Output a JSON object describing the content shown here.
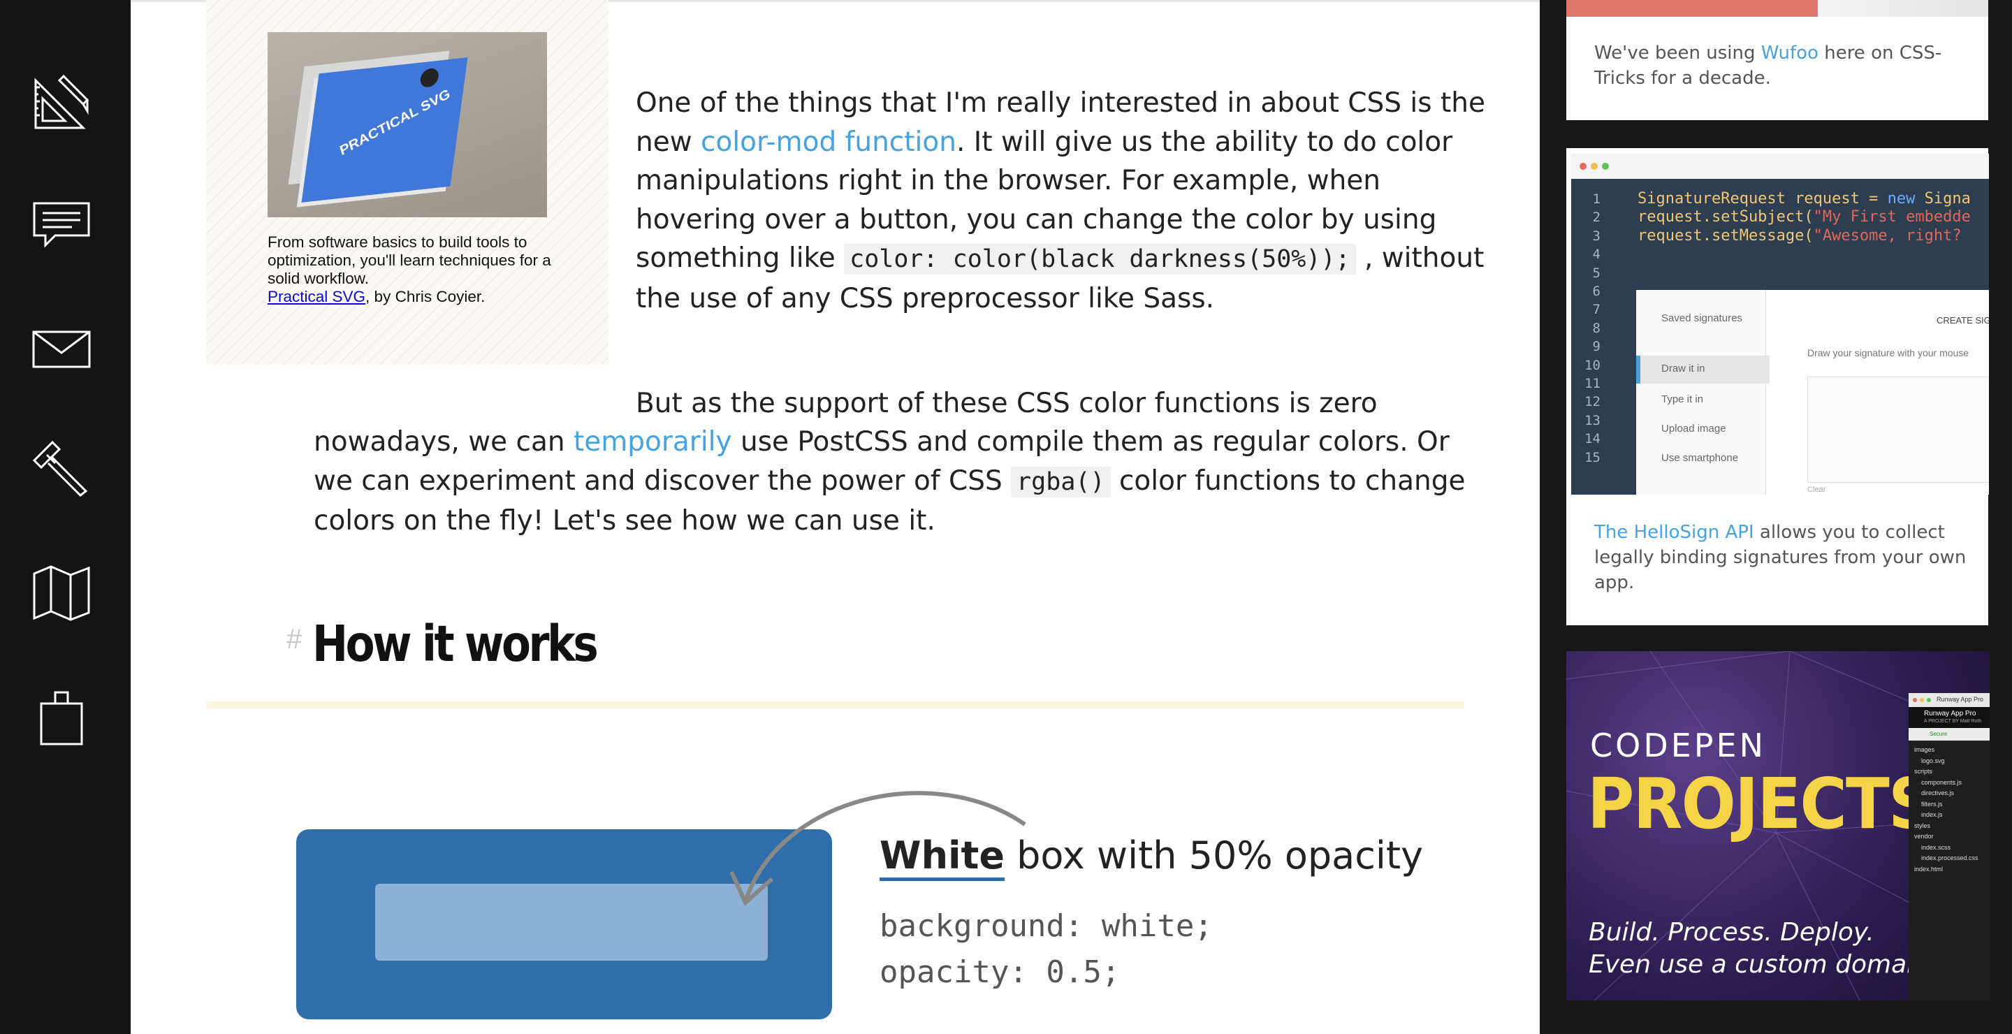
{
  "nav": {
    "items": [
      {
        "name": "articles",
        "icon": "ruler-pencil-icon"
      },
      {
        "name": "forums",
        "icon": "chat-bubble-icon"
      },
      {
        "name": "newsletter",
        "icon": "envelope-icon"
      },
      {
        "name": "tools",
        "icon": "hammer-icon"
      },
      {
        "name": "guides",
        "icon": "map-icon"
      },
      {
        "name": "store",
        "icon": "shopping-bag-icon"
      }
    ]
  },
  "book_ad": {
    "caption": "From software basics to build tools to optimization, you'll learn techniques for a solid workflow.",
    "book_link": "Practical SVG",
    "byline": ", by Chris Coyier.",
    "cover_title": "PRACTICAL SVG"
  },
  "article": {
    "p1_part1": "One of the things that I'm really interested in about CSS is the new ",
    "p1_link": "color-mod function",
    "p1_part2": ". It will give us the ability to do color manipulations right in the browser. For example, when hovering over a button, you can change the color by using something like ",
    "p1_code": "color: color(black darkness(50%));",
    "p1_part3": " , without the use of any CSS preprocessor like Sass.",
    "p2_part1": "But as the support of these CSS color functions is zero",
    "p2_part2": "nowadays, we can ",
    "p2_link": "temporarily",
    "p2_part3": " use PostCSS and compile them as regular colors. Or we can experiment and discover the power of CSS ",
    "p2_code": "rgba()",
    "p2_part4": " color functions to change colors on the fly! Let's see how we can use it.",
    "heading_anchor": "#",
    "heading": "How it works",
    "figure": {
      "label_bold": "White",
      "label_rest": " box with 50% opacity",
      "code_line1": "background: white;",
      "code_line2": "opacity: 0.5;"
    }
  },
  "sidebar": {
    "wufoo": {
      "text_before": "We've been using ",
      "link": "Wufoo",
      "text_after": " here on CSS-Tricks for a decade."
    },
    "hellosign": {
      "link": "The HelloSign API",
      "text_after": " allows you to collect legally binding signatures from your own app.",
      "code_lines": [
        {
          "n": "1",
          "text": "SignatureRequest request = new Signa"
        },
        {
          "n": "2",
          "text": "request.setSubject(\"My First embedde"
        },
        {
          "n": "3",
          "text": "request.setMessage(\"Awesome, right?"
        },
        {
          "n": "4",
          "text": ""
        },
        {
          "n": "5",
          "text": ""
        },
        {
          "n": "6",
          "text": ""
        },
        {
          "n": "7",
          "text": ""
        },
        {
          "n": "8",
          "text": ""
        },
        {
          "n": "9",
          "text": ""
        },
        {
          "n": "10",
          "text": ""
        },
        {
          "n": "11",
          "text": ""
        },
        {
          "n": "12",
          "text": ""
        },
        {
          "n": "13",
          "text": ""
        },
        {
          "n": "14",
          "text": ""
        },
        {
          "n": "15",
          "text": ""
        }
      ],
      "ui_items": [
        "Saved signatures",
        "Draw it in",
        "Type it in",
        "Upload image",
        "Use smartphone"
      ],
      "ui_heading": "CREATE SIG",
      "ui_hint": "Draw your signature with your mouse",
      "ui_clear": "Clear"
    },
    "codepen": {
      "brand": "CODEPEN",
      "title": "PROJECTS",
      "tagline1": "Build. Process. Deploy.",
      "tagline2": "Even use a custom domain.",
      "panel_title": "Runway App Pro",
      "panel_sub": "A PROJECT BY Matt Roth",
      "panel_secure": "Secure",
      "panel_files": [
        "images",
        "logo.svg",
        "scripts",
        "components.js",
        "directives.js",
        "filters.js",
        "index.js",
        "styles",
        "vendor",
        "index.scss",
        "index.processed.css",
        "index.html"
      ]
    }
  },
  "colors": {
    "link": "#47a3e0",
    "nav_bg": "#141414",
    "sidebar_bg": "#171717",
    "demo_blue": "#2f6ea8",
    "codepen_yellow": "#f5d547",
    "wufoo_bar": "#e0776c"
  }
}
